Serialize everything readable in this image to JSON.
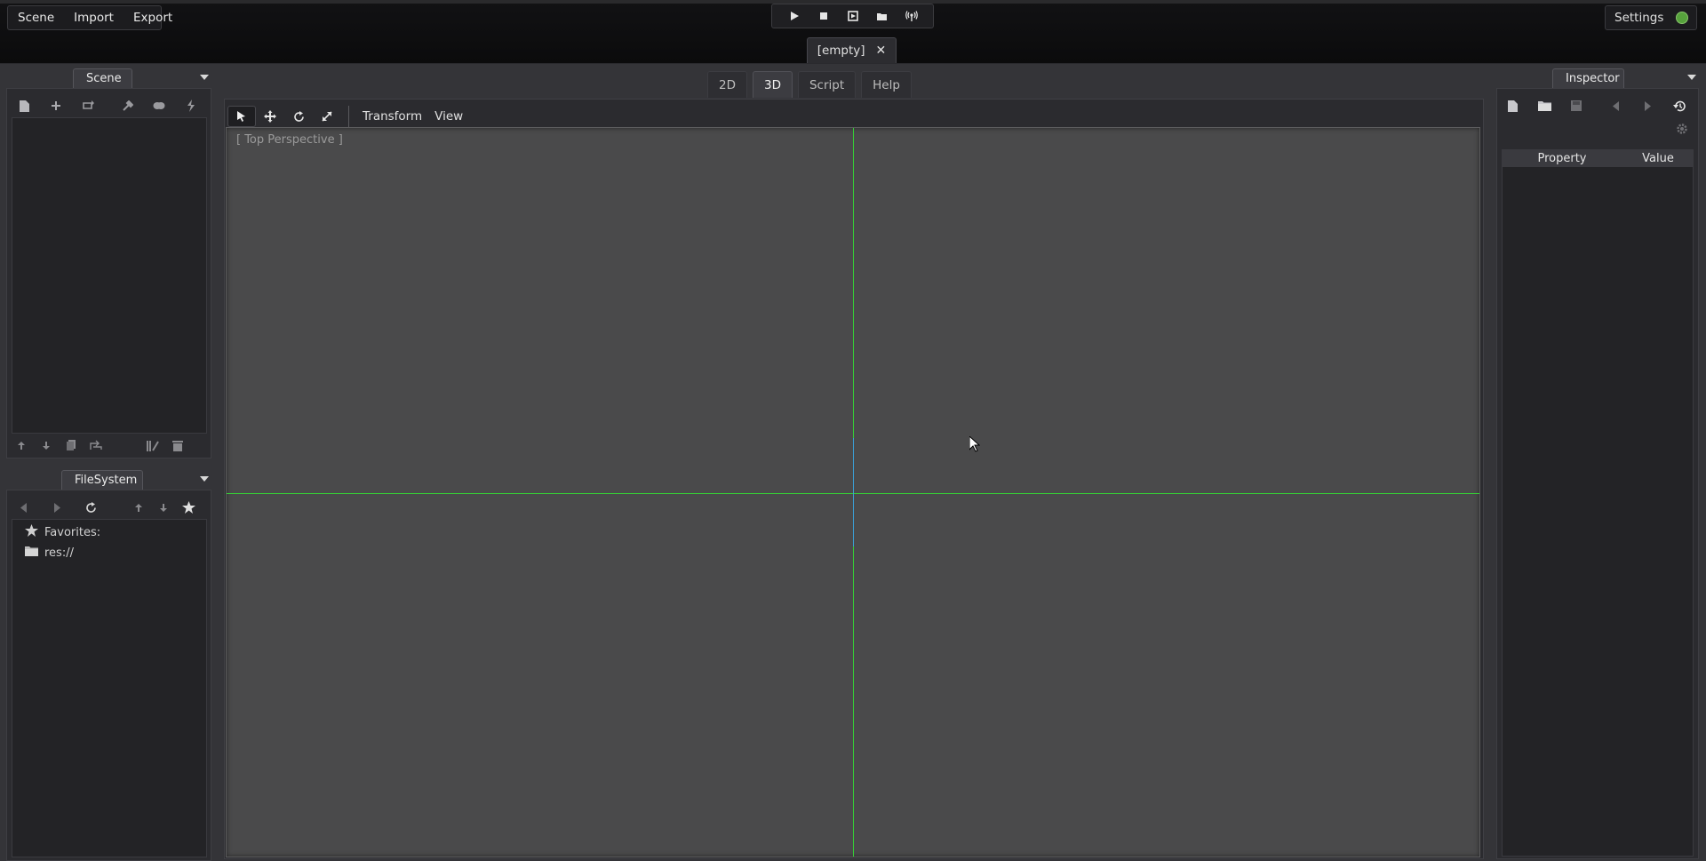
{
  "topbar": {
    "menus": [
      "Scene",
      "Import",
      "Export"
    ],
    "play_buttons": [
      "play-icon",
      "stop-icon",
      "play-scene-icon",
      "play-custom-scene-icon",
      "remote-debug-icon"
    ],
    "settings_label": "Settings",
    "scene_tab": {
      "label": "[empty]"
    }
  },
  "scene_dock": {
    "tab_label": "Scene",
    "toolbar_icons": [
      "new-node-icon",
      "add-instance-icon",
      "replace-node-icon",
      "connect-signal-icon",
      "groups-icon",
      "script-icon"
    ],
    "bottom_icons": [
      "move-up-icon",
      "move-down-icon",
      "duplicate-icon",
      "reparent-icon",
      "edit-script-icon",
      "delete-icon"
    ]
  },
  "filesystem_dock": {
    "tab_label": "FileSystem",
    "items": [
      {
        "label": "Favorites:",
        "icon": "star-icon"
      },
      {
        "label": "res://",
        "icon": "folder-icon"
      }
    ]
  },
  "main_tabs": [
    {
      "label": "2D",
      "active": false
    },
    {
      "label": "3D",
      "active": true
    },
    {
      "label": "Script",
      "active": false
    },
    {
      "label": "Help",
      "active": false
    }
  ],
  "viewport_toolbar": {
    "menus": [
      "Transform",
      "View"
    ]
  },
  "viewport": {
    "label": "[ Top Perspective ]"
  },
  "inspector": {
    "tab_label": "Inspector",
    "columns": [
      "Property",
      "Value"
    ]
  },
  "colors": {
    "axis_green": "#35d335",
    "axis_blue": "#3aa0d8",
    "settings_status": "#56a23c"
  }
}
